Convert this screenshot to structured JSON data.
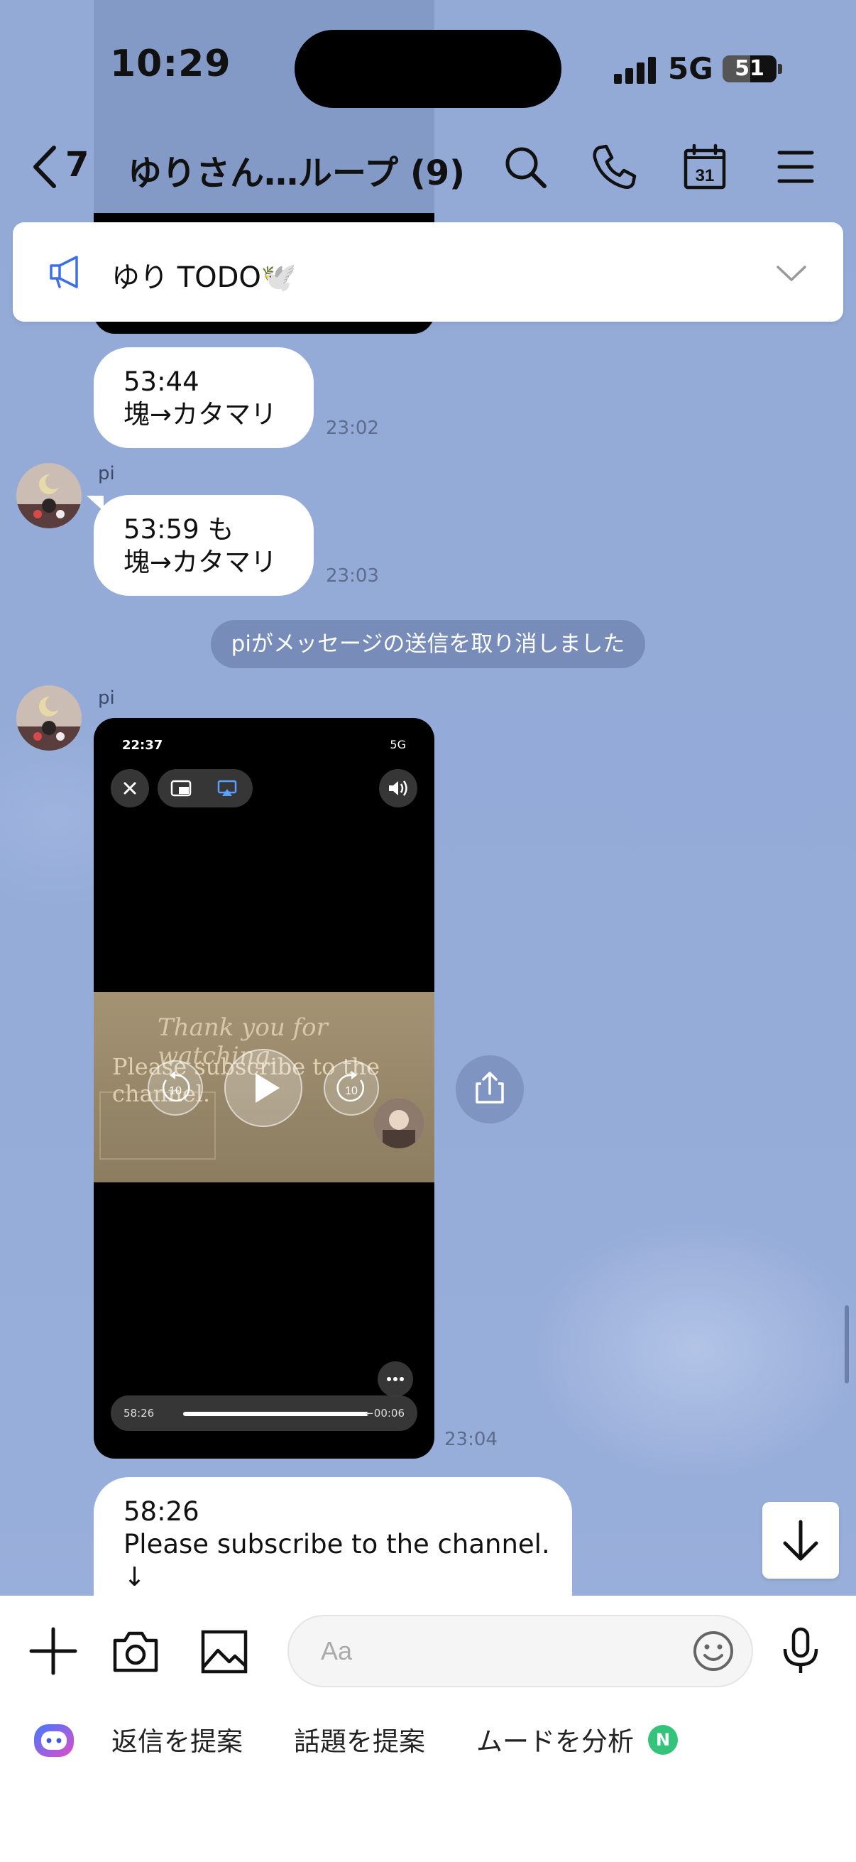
{
  "status_bar": {
    "time": "10:29",
    "network": "5G",
    "battery": "51",
    "battery_level": 0.51
  },
  "header": {
    "back_count": "7",
    "title": "ゆりさん…ループ (9)",
    "icons": [
      "search-icon",
      "phone-icon",
      "calendar-icon",
      "menu-icon"
    ],
    "calendar_day": "31"
  },
  "announcement": {
    "text": "ゆり TODO🕊️"
  },
  "messages": [
    {
      "type": "text",
      "lines": [
        "53:44",
        "塊→カタマリ"
      ],
      "time": "23:02"
    },
    {
      "type": "text",
      "sender": "pi",
      "lines": [
        "53:59 も",
        "塊→カタマリ"
      ],
      "time": "23:03"
    },
    {
      "type": "system",
      "text": "piがメッセージの送信を取り消しました"
    },
    {
      "type": "video",
      "sender": "pi",
      "time": "23:04",
      "video": {
        "status_time": "22:37",
        "status_network": "5G",
        "line1": "Thank you for watching.",
        "line2": "Please subscribe to the channel.",
        "skip_back": "10",
        "skip_forward": "10",
        "position": "58:26",
        "remaining": "−00:06",
        "progress": 0.99
      }
    },
    {
      "type": "text",
      "lines": [
        "58:26",
        "Please subscribe to the channel.",
        "↓"
      ]
    }
  ],
  "composer": {
    "placeholder": "Aa"
  },
  "suggestions": [
    {
      "label": "返信を提案"
    },
    {
      "label": "話題を提案"
    },
    {
      "label": "ムードを分析",
      "badge": "N"
    }
  ]
}
